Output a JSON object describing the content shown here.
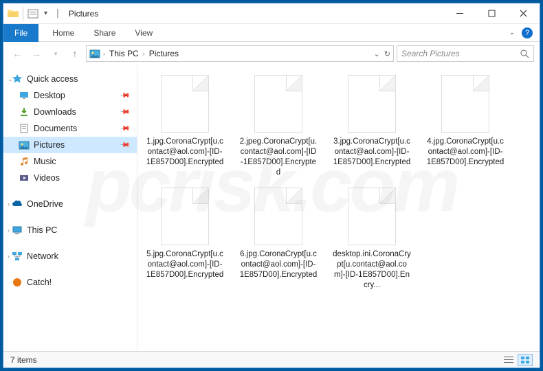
{
  "window": {
    "title": "Pictures"
  },
  "ribbon": {
    "file": "File",
    "tabs": [
      "Home",
      "Share",
      "View"
    ]
  },
  "breadcrumb": {
    "items": [
      "This PC",
      "Pictures"
    ]
  },
  "search": {
    "placeholder": "Search Pictures"
  },
  "sidebar": {
    "quick_access": {
      "label": "Quick access",
      "items": [
        {
          "label": "Desktop",
          "pinned": true,
          "icon": "desktop"
        },
        {
          "label": "Downloads",
          "pinned": true,
          "icon": "downloads"
        },
        {
          "label": "Documents",
          "pinned": true,
          "icon": "documents"
        },
        {
          "label": "Pictures",
          "pinned": true,
          "icon": "pictures",
          "selected": true
        },
        {
          "label": "Music",
          "pinned": false,
          "icon": "music"
        },
        {
          "label": "Videos",
          "pinned": false,
          "icon": "videos"
        }
      ]
    },
    "onedrive": {
      "label": "OneDrive"
    },
    "thispc": {
      "label": "This PC"
    },
    "network": {
      "label": "Network"
    },
    "catch": {
      "label": "Catch!"
    }
  },
  "files": [
    {
      "name": "1.jpg.CoronaCrypt[u.contact@aol.com]-[ID-1E857D00].Encrypted"
    },
    {
      "name": "2.jpeg.CoronaCrypt[u.contact@aol.com]-[ID-1E857D00].Encrypted"
    },
    {
      "name": "3.jpg.CoronaCrypt[u.contact@aol.com]-[ID-1E857D00].Encrypted"
    },
    {
      "name": "4.jpg.CoronaCrypt[u.contact@aol.com]-[ID-1E857D00].Encrypted"
    },
    {
      "name": "5.jpg.CoronaCrypt[u.contact@aol.com]-[ID-1E857D00].Encrypted"
    },
    {
      "name": "6.jpg.CoronaCrypt[u.contact@aol.com]-[ID-1E857D00].Encrypted"
    },
    {
      "name": "desktop.ini.CoronaCrypt[u.contact@aol.com]-[ID-1E857D00].Encry..."
    }
  ],
  "status": {
    "count_label": "7 items"
  },
  "watermark": "pcrisk.com"
}
